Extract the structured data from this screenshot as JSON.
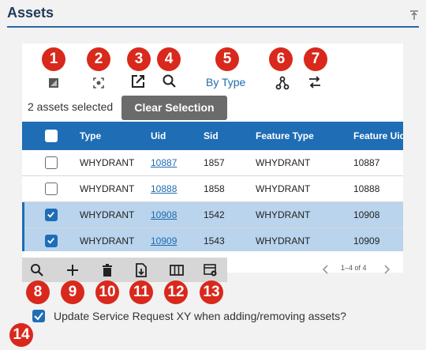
{
  "header": {
    "title": "Assets",
    "collapse_icon": "collapse-to-top-icon"
  },
  "toolbar": {
    "bytype_label": "By Type",
    "badges": [
      "1",
      "2",
      "3",
      "4",
      "5",
      "6",
      "7"
    ]
  },
  "selection": {
    "count_text": "2 assets selected",
    "clear_label": "Clear Selection"
  },
  "grid": {
    "columns": [
      "Type",
      "Uid",
      "Sid",
      "Feature Type",
      "Feature Uid"
    ],
    "rows": [
      {
        "type": "WHYDRANT",
        "uid": "10887",
        "sid": "1857",
        "feature_type": "WHYDRANT",
        "feature_uid": "10887",
        "selected": false
      },
      {
        "type": "WHYDRANT",
        "uid": "10888",
        "sid": "1858",
        "feature_type": "WHYDRANT",
        "feature_uid": "10888",
        "selected": false
      },
      {
        "type": "WHYDRANT",
        "uid": "10908",
        "sid": "1542",
        "feature_type": "WHYDRANT",
        "feature_uid": "10908",
        "selected": true
      },
      {
        "type": "WHYDRANT",
        "uid": "10909",
        "sid": "1543",
        "feature_type": "WHYDRANT",
        "feature_uid": "10909",
        "selected": true
      }
    ]
  },
  "grid_toolbar": {
    "badges": [
      "8",
      "9",
      "10",
      "11",
      "12",
      "13"
    ]
  },
  "pager": {
    "text": "1–4 of 4"
  },
  "update_option": {
    "label": "Update Service Request XY when adding/removing assets?",
    "checked": true,
    "badge": "14"
  },
  "colors": {
    "accent": "#1e6db5",
    "badge": "#d9281c",
    "selected_row": "#b9d4ec"
  }
}
